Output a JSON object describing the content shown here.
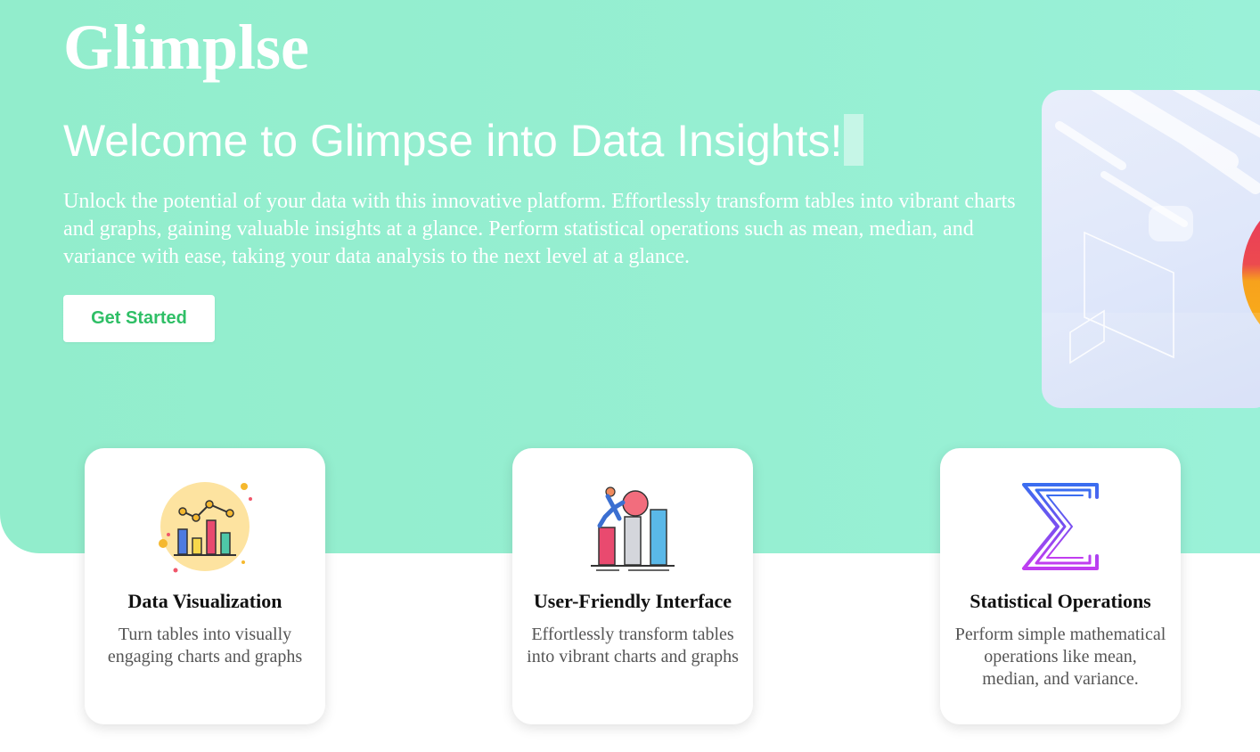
{
  "brand": {
    "name": "Glimplse"
  },
  "hero": {
    "headline": "Welcome to Glimpse into Data Insights!",
    "intro": "Unlock the potential of your data with this innovative platform. Effortlessly transform tables into vibrant charts and graphs, gaining valuable insights at a glance. Perform statistical operations such as mean, median, and variance with ease, taking your data analysis to the next level at a glance.",
    "cta_label": "Get Started",
    "illustration": "abstract-data-illustration"
  },
  "features": [
    {
      "title": "Data Visualization",
      "description": "Turn tables into visually engaging charts and graphs",
      "icon": "bar-chart-icon"
    },
    {
      "title": "User-Friendly Interface",
      "description": "Effortlessly transform tables into vibrant charts and graphs",
      "icon": "climbing-bars-icon"
    },
    {
      "title": "Statistical Operations",
      "description": "Perform simple mathematical operations like mean, median, and variance.",
      "icon": "sigma-icon"
    }
  ],
  "colors": {
    "hero_background": "#96efd2",
    "button_text": "#2fbf66",
    "heading_text": "#111111",
    "body_text": "#555555"
  }
}
